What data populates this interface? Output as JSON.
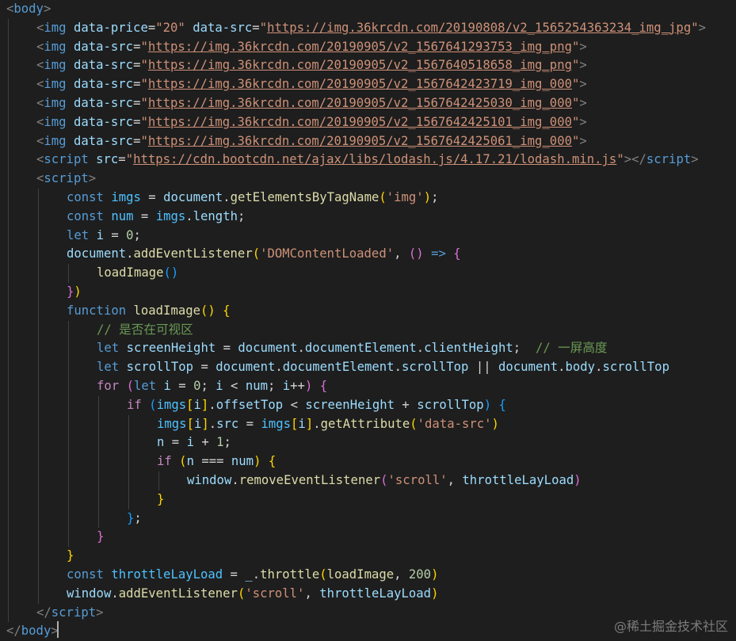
{
  "watermark": "@稀土掘金技术社区",
  "code_lines": [
    [
      [
        "tag",
        "<"
      ],
      [
        "tagname",
        "body"
      ],
      [
        "tag",
        ">"
      ]
    ],
    [
      [
        "tag",
        "<"
      ],
      [
        "tagname",
        "img"
      ],
      [
        "op",
        " "
      ],
      [
        "attr",
        "data-price"
      ],
      [
        "op",
        "="
      ],
      [
        "str",
        "\"20\""
      ],
      [
        "op",
        " "
      ],
      [
        "attr",
        "data-src"
      ],
      [
        "op",
        "="
      ],
      [
        "str",
        "\""
      ],
      [
        "url",
        "https://img.36krcdn.com/20190808/v2_1565254363234_img_jpg"
      ],
      [
        "str",
        "\""
      ],
      [
        "tag",
        ">"
      ]
    ],
    [
      [
        "tag",
        "<"
      ],
      [
        "tagname",
        "img"
      ],
      [
        "op",
        " "
      ],
      [
        "attr",
        "data-src"
      ],
      [
        "op",
        "="
      ],
      [
        "str",
        "\""
      ],
      [
        "url",
        "https://img.36krcdn.com/20190905/v2_1567641293753_img_png"
      ],
      [
        "str",
        "\""
      ],
      [
        "tag",
        ">"
      ]
    ],
    [
      [
        "tag",
        "<"
      ],
      [
        "tagname",
        "img"
      ],
      [
        "op",
        " "
      ],
      [
        "attr",
        "data-src"
      ],
      [
        "op",
        "="
      ],
      [
        "str",
        "\""
      ],
      [
        "url",
        "https://img.36krcdn.com/20190905/v2_1567640518658_img_png"
      ],
      [
        "str",
        "\""
      ],
      [
        "tag",
        ">"
      ]
    ],
    [
      [
        "tag",
        "<"
      ],
      [
        "tagname",
        "img"
      ],
      [
        "op",
        " "
      ],
      [
        "attr",
        "data-src"
      ],
      [
        "op",
        "="
      ],
      [
        "str",
        "\""
      ],
      [
        "url",
        "https://img.36krcdn.com/20190905/v2_1567642423719_img_000"
      ],
      [
        "str",
        "\""
      ],
      [
        "tag",
        ">"
      ]
    ],
    [
      [
        "tag",
        "<"
      ],
      [
        "tagname",
        "img"
      ],
      [
        "op",
        " "
      ],
      [
        "attr",
        "data-src"
      ],
      [
        "op",
        "="
      ],
      [
        "str",
        "\""
      ],
      [
        "url",
        "https://img.36krcdn.com/20190905/v2_1567642425030_img_000"
      ],
      [
        "str",
        "\""
      ],
      [
        "tag",
        ">"
      ]
    ],
    [
      [
        "tag",
        "<"
      ],
      [
        "tagname",
        "img"
      ],
      [
        "op",
        " "
      ],
      [
        "attr",
        "data-src"
      ],
      [
        "op",
        "="
      ],
      [
        "str",
        "\""
      ],
      [
        "url",
        "https://img.36krcdn.com/20190905/v2_1567642425101_img_000"
      ],
      [
        "str",
        "\""
      ],
      [
        "tag",
        ">"
      ]
    ],
    [
      [
        "tag",
        "<"
      ],
      [
        "tagname",
        "img"
      ],
      [
        "op",
        " "
      ],
      [
        "attr",
        "data-src"
      ],
      [
        "op",
        "="
      ],
      [
        "str",
        "\""
      ],
      [
        "url",
        "https://img.36krcdn.com/20190905/v2_1567642425061_img_000"
      ],
      [
        "str",
        "\""
      ],
      [
        "tag",
        ">"
      ]
    ],
    [
      [
        "tag",
        "<"
      ],
      [
        "tagname",
        "script"
      ],
      [
        "op",
        " "
      ],
      [
        "attr",
        "src"
      ],
      [
        "op",
        "="
      ],
      [
        "str",
        "\""
      ],
      [
        "url",
        "https://cdn.bootcdn.net/ajax/libs/lodash.js/4.17.21/lodash.min.js"
      ],
      [
        "str",
        "\""
      ],
      [
        "tag",
        "></"
      ],
      [
        "tagname",
        "script"
      ],
      [
        "tag",
        ">"
      ]
    ],
    [
      [
        "tag",
        "<"
      ],
      [
        "tagname",
        "script"
      ],
      [
        "tag",
        ">"
      ]
    ],
    [
      [
        "kw",
        "const"
      ],
      [
        "op",
        " "
      ],
      [
        "cst",
        "imgs"
      ],
      [
        "op",
        " = "
      ],
      [
        "var",
        "document"
      ],
      [
        "op",
        "."
      ],
      [
        "fn",
        "getElementsByTagName"
      ],
      [
        "br1",
        "("
      ],
      [
        "str",
        "'img'"
      ],
      [
        "br1",
        ")"
      ],
      [
        "op",
        ";"
      ]
    ],
    [
      [
        "kw",
        "const"
      ],
      [
        "op",
        " "
      ],
      [
        "cst",
        "num"
      ],
      [
        "op",
        " = "
      ],
      [
        "cst",
        "imgs"
      ],
      [
        "op",
        "."
      ],
      [
        "var",
        "length"
      ],
      [
        "op",
        ";"
      ]
    ],
    [
      [
        "kw",
        "let"
      ],
      [
        "op",
        " "
      ],
      [
        "var",
        "i"
      ],
      [
        "op",
        " = "
      ],
      [
        "num",
        "0"
      ],
      [
        "op",
        ";"
      ]
    ],
    [
      [
        "var",
        "document"
      ],
      [
        "op",
        "."
      ],
      [
        "fn",
        "addEventListener"
      ],
      [
        "br1",
        "("
      ],
      [
        "str",
        "'DOMContentLoaded'"
      ],
      [
        "op",
        ", "
      ],
      [
        "br2",
        "()"
      ],
      [
        "op",
        " "
      ],
      [
        "kw",
        "=>"
      ],
      [
        "op",
        " "
      ],
      [
        "br2",
        "{"
      ]
    ],
    [
      [
        "fn",
        "loadImage"
      ],
      [
        "br3",
        "()"
      ]
    ],
    [
      [
        "br2",
        "}"
      ],
      [
        "br1",
        ")"
      ]
    ],
    [
      [
        "kw",
        "function"
      ],
      [
        "op",
        " "
      ],
      [
        "fn",
        "loadImage"
      ],
      [
        "br1",
        "()"
      ],
      [
        "op",
        " "
      ],
      [
        "br1",
        "{"
      ]
    ],
    [
      [
        "cmt",
        "// 是否在可视区"
      ]
    ],
    [
      [
        "kw",
        "let"
      ],
      [
        "op",
        " "
      ],
      [
        "var",
        "screenHeight"
      ],
      [
        "op",
        " = "
      ],
      [
        "var",
        "document"
      ],
      [
        "op",
        "."
      ],
      [
        "var",
        "documentElement"
      ],
      [
        "op",
        "."
      ],
      [
        "var",
        "clientHeight"
      ],
      [
        "op",
        ";  "
      ],
      [
        "cmt",
        "// 一屏高度"
      ]
    ],
    [
      [
        "kw",
        "let"
      ],
      [
        "op",
        " "
      ],
      [
        "var",
        "scrollTop"
      ],
      [
        "op",
        " = "
      ],
      [
        "var",
        "document"
      ],
      [
        "op",
        "."
      ],
      [
        "var",
        "documentElement"
      ],
      [
        "op",
        "."
      ],
      [
        "var",
        "scrollTop"
      ],
      [
        "op",
        " || "
      ],
      [
        "var",
        "document"
      ],
      [
        "op",
        "."
      ],
      [
        "var",
        "body"
      ],
      [
        "op",
        "."
      ],
      [
        "var",
        "scrollTop"
      ]
    ],
    [
      [
        "ctrl",
        "for"
      ],
      [
        "op",
        " "
      ],
      [
        "br2",
        "("
      ],
      [
        "kw",
        "let"
      ],
      [
        "op",
        " "
      ],
      [
        "var",
        "i"
      ],
      [
        "op",
        " = "
      ],
      [
        "num",
        "0"
      ],
      [
        "op",
        "; "
      ],
      [
        "var",
        "i"
      ],
      [
        "op",
        " < "
      ],
      [
        "var",
        "num"
      ],
      [
        "op",
        "; "
      ],
      [
        "var",
        "i"
      ],
      [
        "op",
        "++"
      ],
      [
        "br2",
        ")"
      ],
      [
        "op",
        " "
      ],
      [
        "br2",
        "{"
      ]
    ],
    [
      [
        "ctrl",
        "if"
      ],
      [
        "op",
        " "
      ],
      [
        "br3",
        "("
      ],
      [
        "cst",
        "imgs"
      ],
      [
        "br1",
        "["
      ],
      [
        "var",
        "i"
      ],
      [
        "br1",
        "]"
      ],
      [
        "op",
        "."
      ],
      [
        "var",
        "offsetTop"
      ],
      [
        "op",
        " < "
      ],
      [
        "var",
        "screenHeight"
      ],
      [
        "op",
        " + "
      ],
      [
        "var",
        "scrollTop"
      ],
      [
        "br3",
        ")"
      ],
      [
        "op",
        " "
      ],
      [
        "br3",
        "{"
      ]
    ],
    [
      [
        "cst",
        "imgs"
      ],
      [
        "br1",
        "["
      ],
      [
        "var",
        "i"
      ],
      [
        "br1",
        "]"
      ],
      [
        "op",
        "."
      ],
      [
        "var",
        "src"
      ],
      [
        "op",
        " = "
      ],
      [
        "cst",
        "imgs"
      ],
      [
        "br1",
        "["
      ],
      [
        "var",
        "i"
      ],
      [
        "br1",
        "]"
      ],
      [
        "op",
        "."
      ],
      [
        "fn",
        "getAttribute"
      ],
      [
        "br1",
        "("
      ],
      [
        "str",
        "'data-src'"
      ],
      [
        "br1",
        ")"
      ]
    ],
    [
      [
        "var",
        "n"
      ],
      [
        "op",
        " = "
      ],
      [
        "var",
        "i"
      ],
      [
        "op",
        " + "
      ],
      [
        "num",
        "1"
      ],
      [
        "op",
        ";"
      ]
    ],
    [
      [
        "ctrl",
        "if"
      ],
      [
        "op",
        " "
      ],
      [
        "br1",
        "("
      ],
      [
        "var",
        "n"
      ],
      [
        "op",
        " === "
      ],
      [
        "var",
        "num"
      ],
      [
        "br1",
        ")"
      ],
      [
        "op",
        " "
      ],
      [
        "br1",
        "{"
      ]
    ],
    [
      [
        "var",
        "window"
      ],
      [
        "op",
        "."
      ],
      [
        "fn",
        "removeEventListener"
      ],
      [
        "br2",
        "("
      ],
      [
        "str",
        "'scroll'"
      ],
      [
        "op",
        ", "
      ],
      [
        "var",
        "throttleLayLoad"
      ],
      [
        "br2",
        ")"
      ]
    ],
    [
      [
        "br1",
        "}"
      ]
    ],
    [
      [
        "br3",
        "}"
      ],
      [
        "op",
        ";"
      ]
    ],
    [
      [
        "br2",
        "}"
      ]
    ],
    [
      [
        "br1",
        "}"
      ]
    ],
    [
      [
        "kw",
        "const"
      ],
      [
        "op",
        " "
      ],
      [
        "cst",
        "throttleLayLoad"
      ],
      [
        "op",
        " = "
      ],
      [
        "var",
        "_"
      ],
      [
        "op",
        "."
      ],
      [
        "fn",
        "throttle"
      ],
      [
        "br1",
        "("
      ],
      [
        "fn",
        "loadImage"
      ],
      [
        "op",
        ", "
      ],
      [
        "num",
        "200"
      ],
      [
        "br1",
        ")"
      ]
    ],
    [
      [
        "var",
        "window"
      ],
      [
        "op",
        "."
      ],
      [
        "fn",
        "addEventListener"
      ],
      [
        "br1",
        "("
      ],
      [
        "str",
        "'scroll'"
      ],
      [
        "op",
        ", "
      ],
      [
        "var",
        "throttleLayLoad"
      ],
      [
        "br1",
        ")"
      ]
    ],
    [
      [
        "tag",
        "</"
      ],
      [
        "tagname",
        "script"
      ],
      [
        "tag",
        ">"
      ]
    ],
    [
      [
        "tag",
        "</"
      ],
      [
        "tagname",
        "body"
      ],
      [
        "tag",
        ">"
      ]
    ]
  ]
}
